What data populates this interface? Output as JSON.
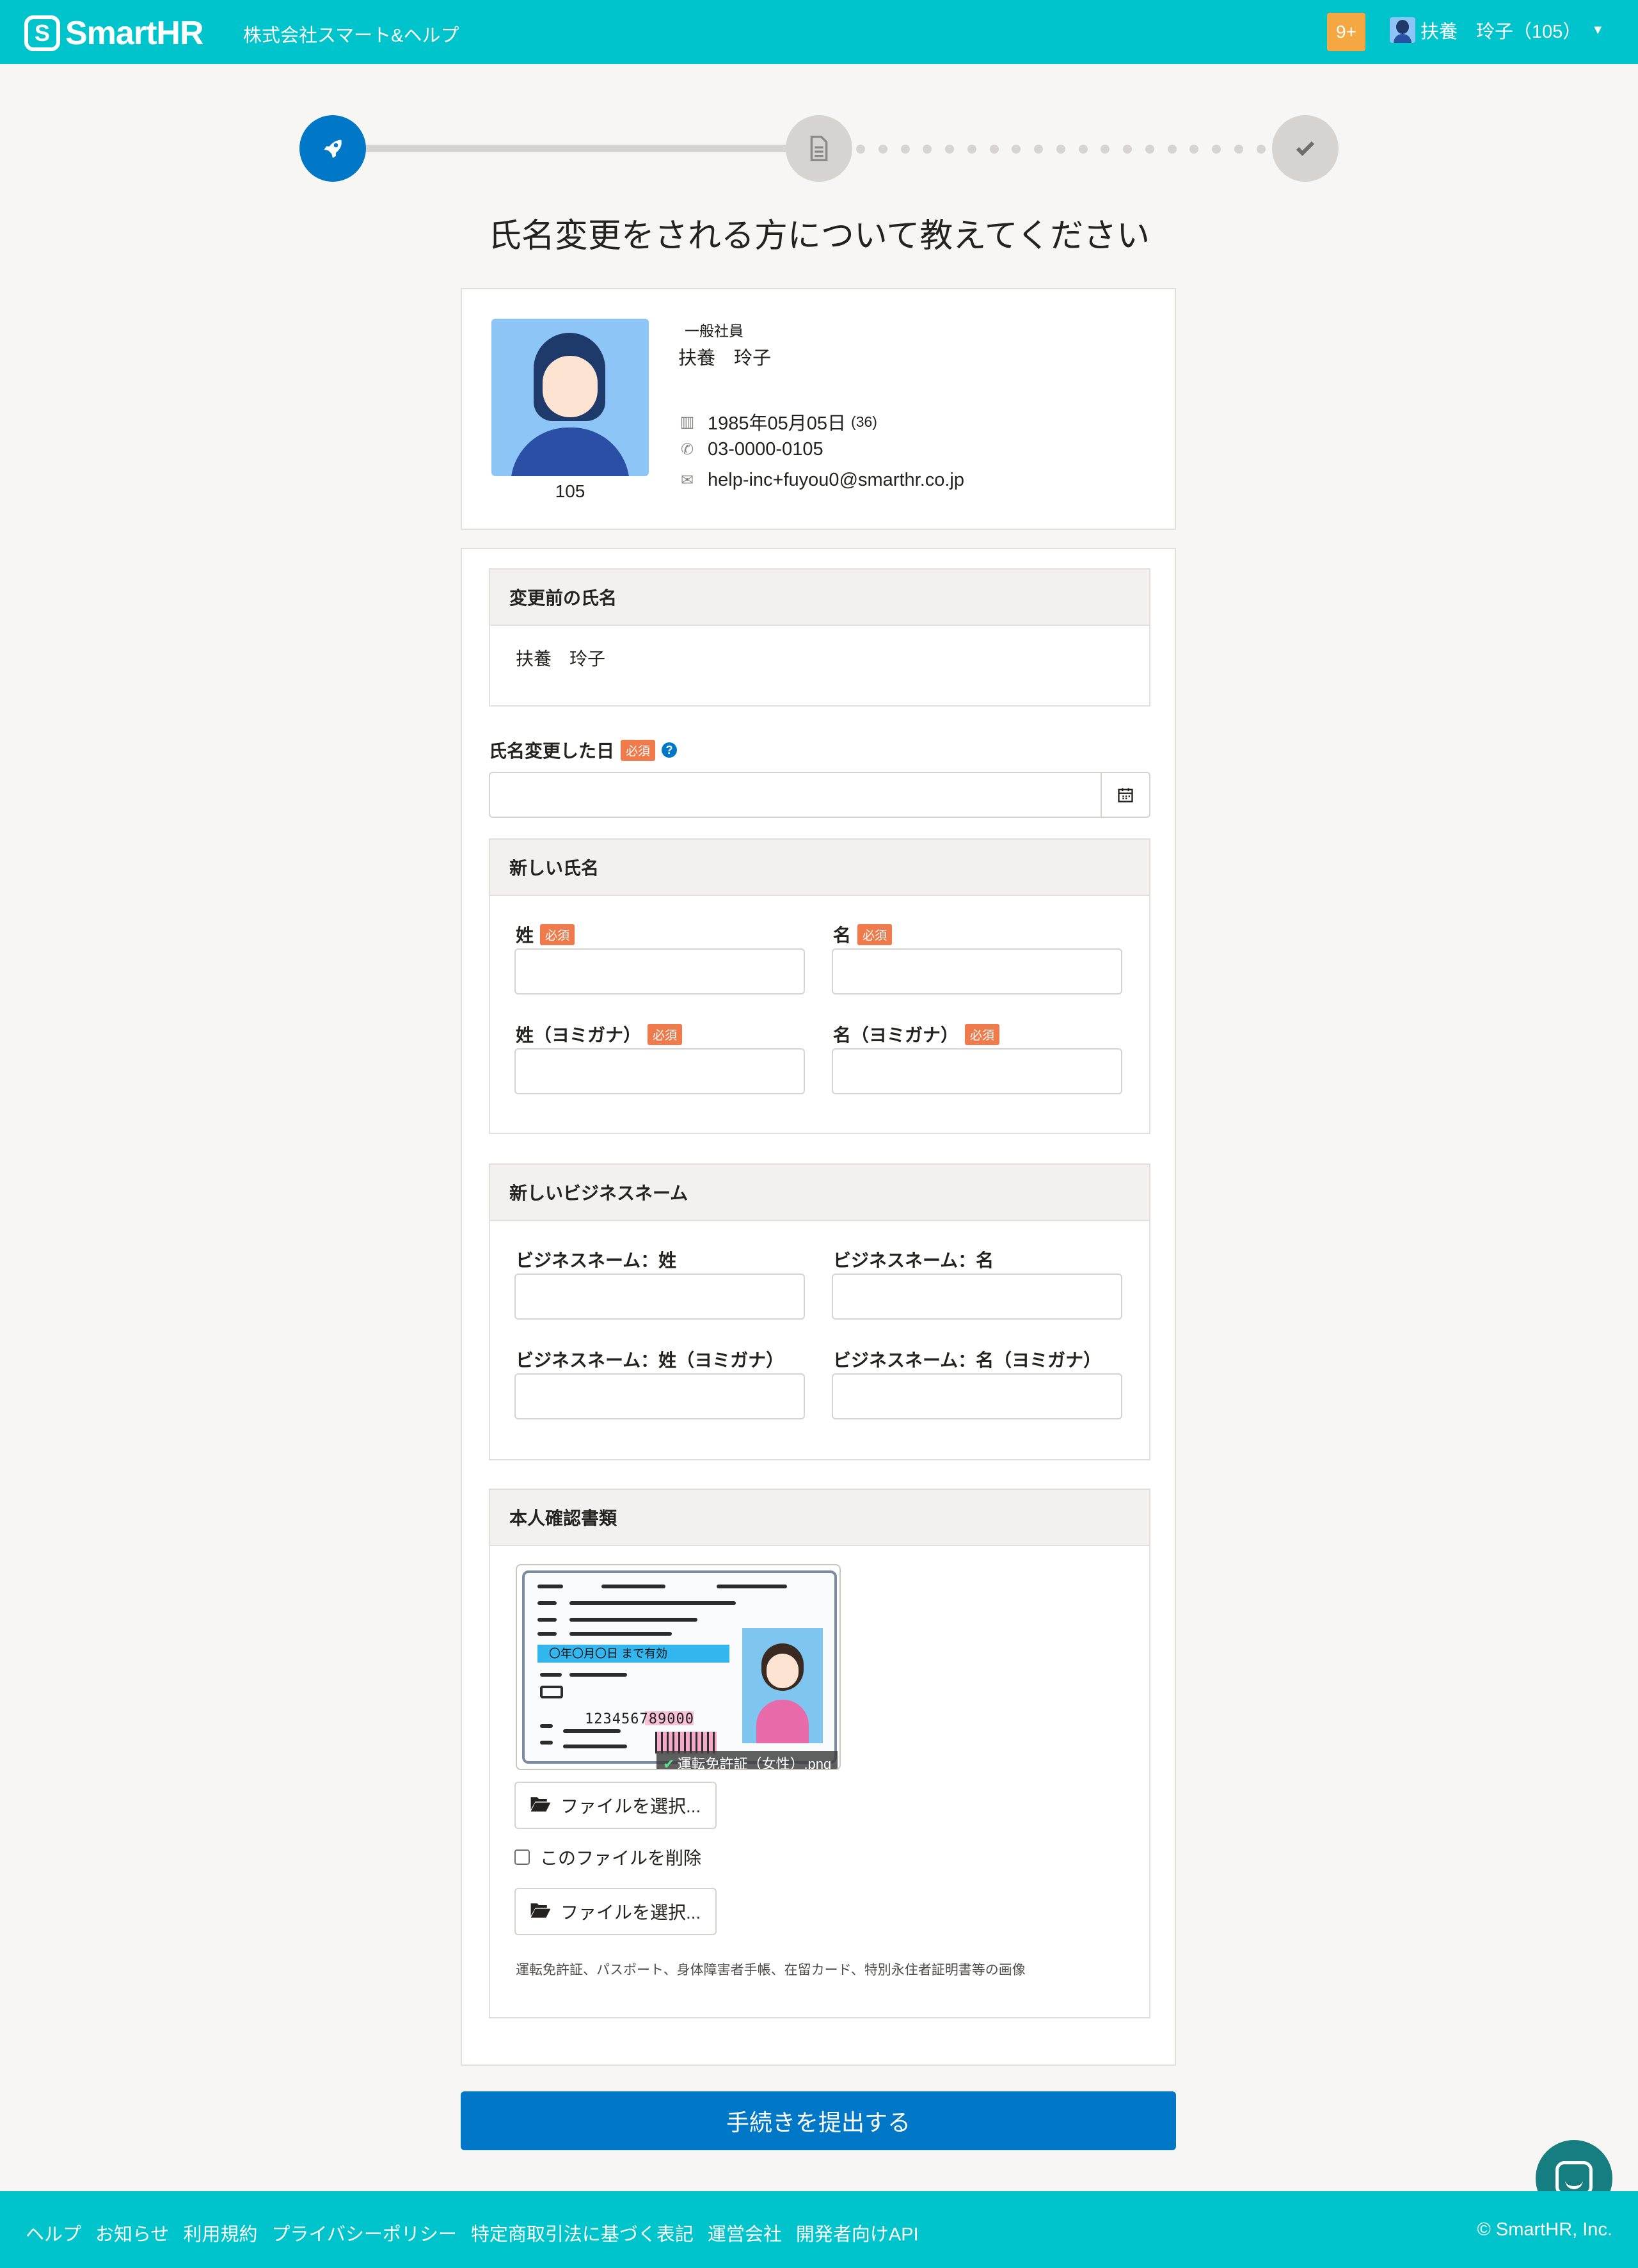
{
  "header": {
    "logo_mark": "S",
    "logo_text": "SmartHR",
    "company": "株式会社スマート&ヘルプ",
    "notification_count": "9+",
    "user_name": "扶養　玲子（105）"
  },
  "stepper": {
    "current_step": 1,
    "total_steps": 3,
    "icons": [
      "rocket-icon",
      "document-icon",
      "check-icon"
    ]
  },
  "page": {
    "title": "氏名変更をされる方について教えてください"
  },
  "profile": {
    "role": "一般社員",
    "name": "扶養　玲子",
    "employee_number": "105",
    "birthday": "1985年05月05日",
    "age": "(36)",
    "phone": "03-0000-0105",
    "email": "help-inc+fuyou0@smarthr.co.jp"
  },
  "form": {
    "old_name_section": {
      "title": "変更前の氏名",
      "value": "扶養　玲子"
    },
    "change_date": {
      "label": "氏名変更した日",
      "required_badge": "必須",
      "help": "?",
      "value": ""
    },
    "new_name_section": {
      "title": "新しい氏名",
      "fields": [
        {
          "label": "姓",
          "required_badge": "必須",
          "value": ""
        },
        {
          "label": "名",
          "required_badge": "必須",
          "value": ""
        },
        {
          "label": "姓（ヨミガナ）",
          "required_badge": "必須",
          "value": ""
        },
        {
          "label": "名（ヨミガナ）",
          "required_badge": "必須",
          "value": ""
        }
      ]
    },
    "business_name_section": {
      "title": "新しいビジネスネーム",
      "fields": [
        {
          "label": "ビジネスネーム：姓",
          "value": ""
        },
        {
          "label": "ビジネスネーム：名",
          "value": ""
        },
        {
          "label": "ビジネスネーム：姓（ヨミガナ）",
          "value": ""
        },
        {
          "label": "ビジネスネーム：名（ヨミガナ）",
          "value": ""
        }
      ]
    },
    "id_document_section": {
      "title": "本人確認書類",
      "license_date_text": "〇年〇月〇日 まで有効",
      "license_number": "123456789000",
      "file_name": "運転免許証（女性）.png",
      "select_file_label": "ファイルを選択...",
      "delete_file_label": "このファイルを削除",
      "delete_file_checked": false,
      "select_file_label_2": "ファイルを選択...",
      "hint": "運転免許証、パスポート、身体障害者手帳、在留カード、特別永住者証明書等の画像"
    },
    "submit_label": "手続きを提出する"
  },
  "footer": {
    "links": [
      "ヘルプ",
      "お知らせ",
      "利用規約",
      "プライバシーポリシー",
      "特定商取引法に基づく表記",
      "運営会社",
      "開発者向けAPI"
    ],
    "copyright": "© SmartHR, Inc."
  },
  "colors": {
    "brand": "#00c4cc",
    "primary": "#0077c7",
    "required": "#ef7a4b",
    "notification": "#f5a742",
    "chat": "#167d80"
  }
}
